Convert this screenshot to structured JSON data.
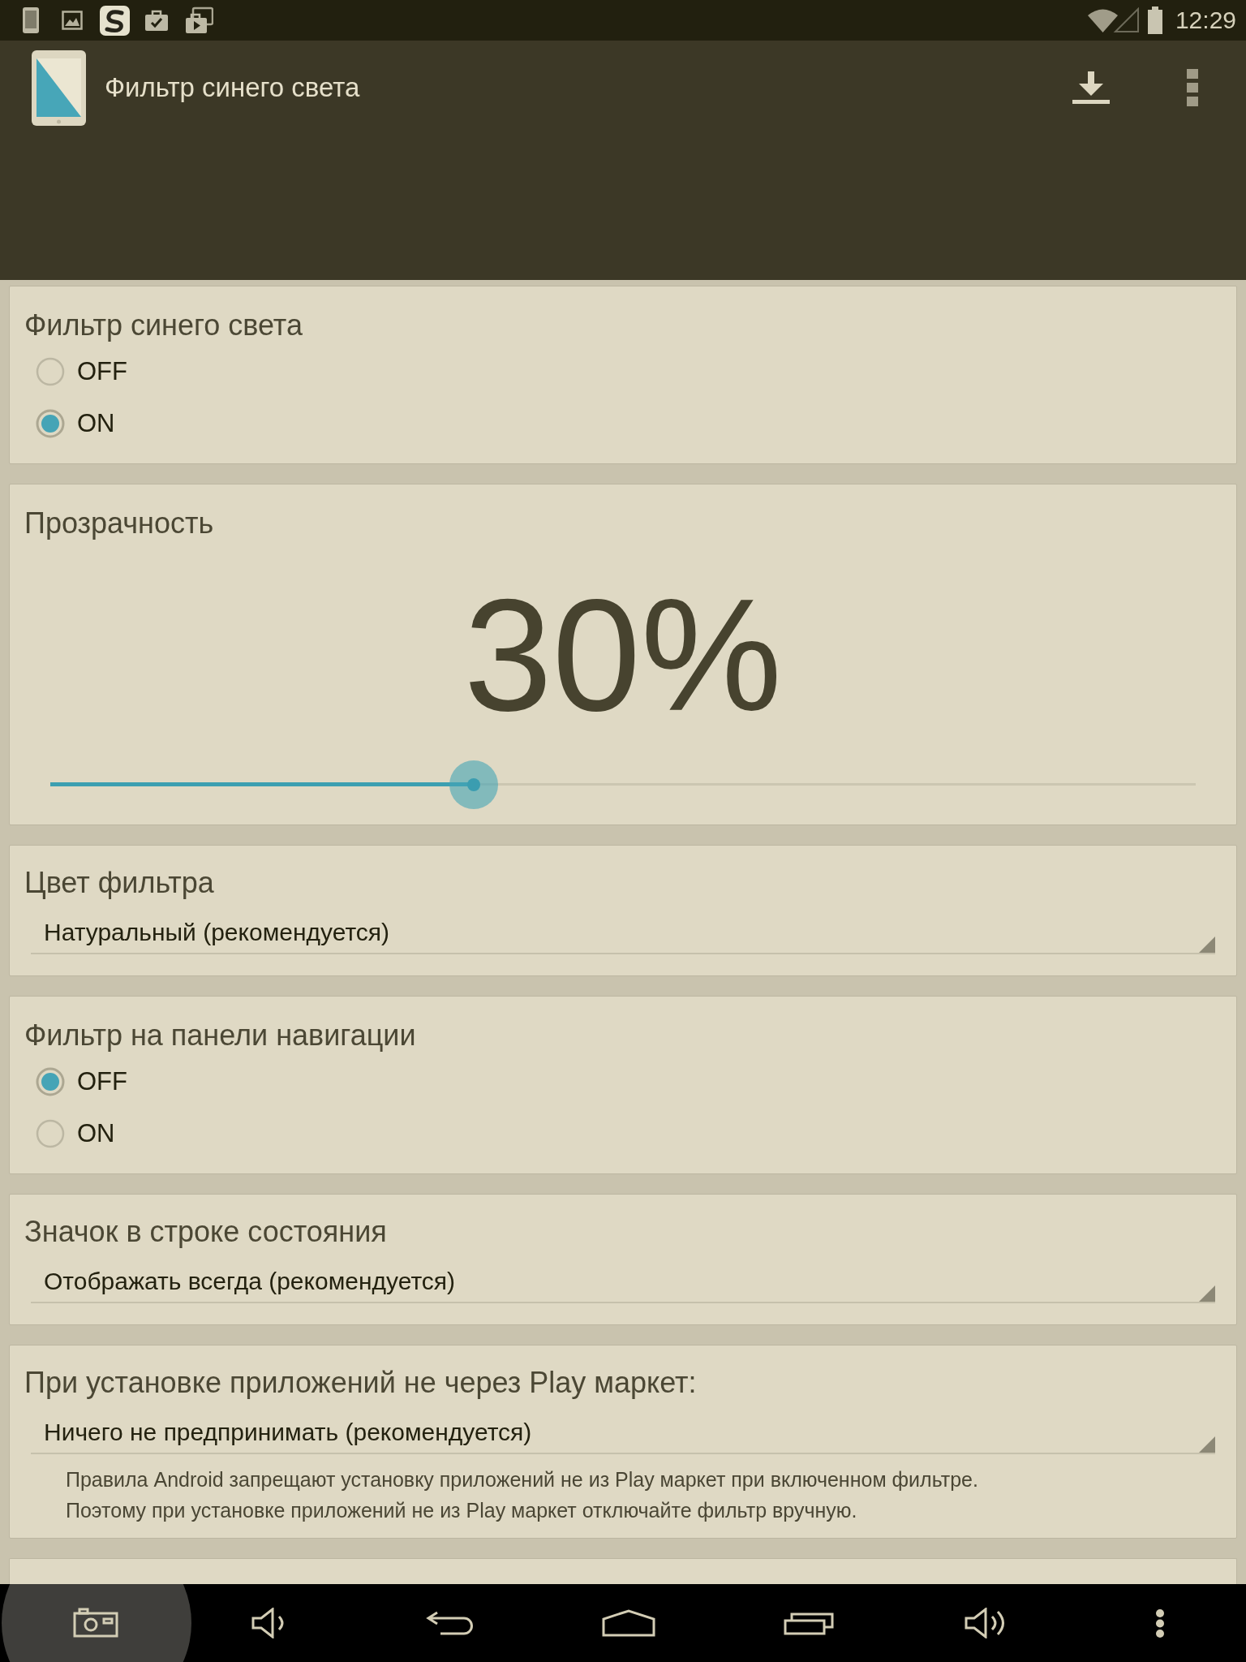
{
  "status_bar": {
    "time": "12:29"
  },
  "app_bar": {
    "title": "Фильтр синего света"
  },
  "sections": [
    {
      "kind": "radio",
      "title": "Фильтр синего света",
      "options": [
        {
          "label": "OFF",
          "selected": false
        },
        {
          "label": "ON",
          "selected": true
        }
      ]
    },
    {
      "kind": "slider",
      "title": "Прозрачность",
      "reading": "30%",
      "level": 0.37
    },
    {
      "kind": "dropdown",
      "title": "Цвет фильтра",
      "value": "Натуральный (рекомендуется)"
    },
    {
      "kind": "radio",
      "title": "Фильтр на панели навигации",
      "options": [
        {
          "label": "OFF",
          "selected": true
        },
        {
          "label": "ON",
          "selected": false
        }
      ]
    },
    {
      "kind": "dropdown",
      "title": "Значок в строке состояния",
      "value": "Отображать всегда (рекомендуется)"
    },
    {
      "kind": "dropdown",
      "title": "При установке приложений не через Play маркет:",
      "value": "Ничего не предпринимать (рекомендуется)",
      "note": "Правила Android запрещают установку приложений не из Play маркет при включенном фильтре.\nПоэтому при установке приложений не из Play маркет отключайте фильтр вручную."
    },
    {
      "kind": "empty"
    }
  ]
}
